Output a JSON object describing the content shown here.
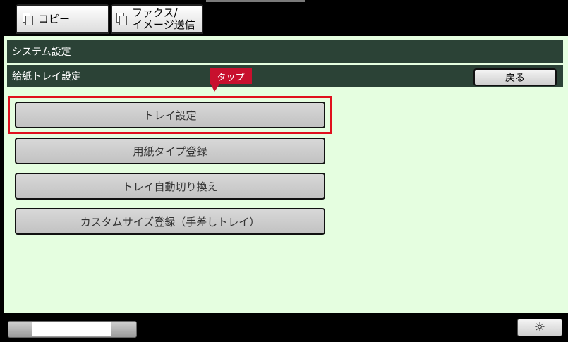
{
  "tabs": {
    "copy_label": "コピー",
    "fax_label_line1": "ファクス/",
    "fax_label_line2": "イメージ送信"
  },
  "header": {
    "title": "システム設定",
    "subtitle": "給紙トレイ設定",
    "back_label": "戻る"
  },
  "annotation": {
    "tap_label": "タップ"
  },
  "menu": {
    "items": [
      {
        "label": "トレイ設定"
      },
      {
        "label": "用紙タイプ登録"
      },
      {
        "label": "トレイ自動切り換え"
      },
      {
        "label": "カスタムサイズ登録（手差しトレイ）"
      }
    ]
  },
  "status": {
    "brightness_icon": "☼"
  },
  "colors": {
    "panel_bg": "#e5fee0",
    "header_bg": "#2b4236",
    "highlight": "#e0101e"
  }
}
